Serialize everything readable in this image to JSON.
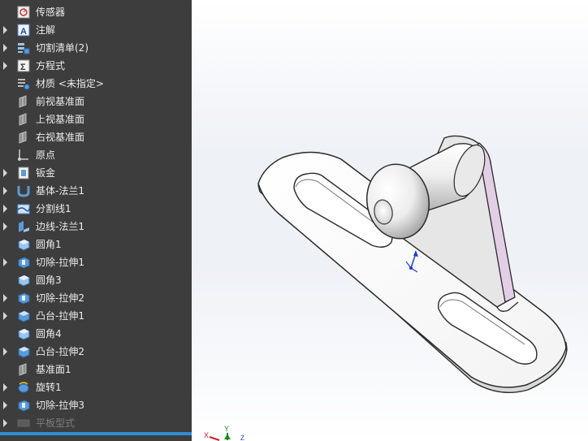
{
  "feature_tree": {
    "items": [
      {
        "label": "传感器",
        "icon": "sensor-icon",
        "expandable": false
      },
      {
        "label": "注解",
        "icon": "annotation-icon",
        "expandable": true
      },
      {
        "label": "切割清单(2)",
        "icon": "cut-list-icon",
        "expandable": true
      },
      {
        "label": "方程式",
        "icon": "equation-icon",
        "expandable": true
      },
      {
        "label": "材质 <未指定>",
        "icon": "material-icon",
        "expandable": false
      },
      {
        "label": "前视基准面",
        "icon": "plane-icon",
        "expandable": false
      },
      {
        "label": "上视基准面",
        "icon": "plane-icon",
        "expandable": false
      },
      {
        "label": "右视基准面",
        "icon": "plane-icon",
        "expandable": false
      },
      {
        "label": "原点",
        "icon": "origin-icon",
        "expandable": false
      },
      {
        "label": "钣金",
        "icon": "sheet-metal-icon",
        "expandable": true
      },
      {
        "label": "基体-法兰1",
        "icon": "base-flange-icon",
        "expandable": true
      },
      {
        "label": "分割线1",
        "icon": "split-line-icon",
        "expandable": true
      },
      {
        "label": "边线-法兰1",
        "icon": "edge-flange-icon",
        "expandable": true
      },
      {
        "label": "圆角1",
        "icon": "fillet-icon",
        "expandable": false
      },
      {
        "label": "切除-拉伸1",
        "icon": "cut-extrude-icon",
        "expandable": true
      },
      {
        "label": "圆角3",
        "icon": "fillet-icon",
        "expandable": false
      },
      {
        "label": "切除-拉伸2",
        "icon": "cut-extrude-icon",
        "expandable": true
      },
      {
        "label": "凸台-拉伸1",
        "icon": "boss-extrude-icon",
        "expandable": true
      },
      {
        "label": "圆角4",
        "icon": "fillet-icon",
        "expandable": false
      },
      {
        "label": "凸台-拉伸2",
        "icon": "boss-extrude-icon",
        "expandable": true
      },
      {
        "label": "基准面1",
        "icon": "plane-icon",
        "expandable": false
      },
      {
        "label": "旋转1",
        "icon": "revolve-icon",
        "expandable": true
      },
      {
        "label": "切除-拉伸3",
        "icon": "cut-extrude-icon",
        "expandable": true
      },
      {
        "label": "平板型式",
        "icon": "flat-pattern-icon",
        "expandable": true,
        "suppressed": true
      }
    ]
  },
  "triad": {
    "x": "X",
    "y": "Y",
    "z": "Z"
  },
  "colors": {
    "tree_bg": "#3d3d3d",
    "accent": "#2f8fd6",
    "bend_face": "#e2cfe6"
  }
}
